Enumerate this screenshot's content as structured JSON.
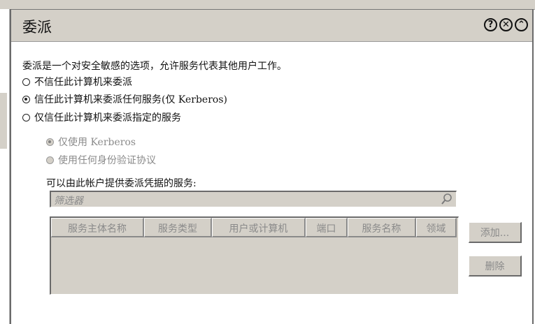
{
  "dialog": {
    "title": "委派",
    "header_buttons": {
      "help_icon": "?",
      "close_icon": "✕",
      "collapse_icon": "⌃"
    }
  },
  "description": "委派是一个对安全敏感的选项，允许服务代表其他用户工作。",
  "delegation_options": [
    {
      "label": "不信任此计算机来委派",
      "selected": false
    },
    {
      "label": "信任此计算机来委派任何服务(仅 Kerberos)",
      "selected": true
    },
    {
      "label": "仅信任此计算机来委派指定的服务",
      "selected": false
    }
  ],
  "protocol_options": [
    {
      "label": "仅使用 Kerberos",
      "selected": true,
      "disabled": true
    },
    {
      "label": "使用任何身份验证协议",
      "selected": false,
      "disabled": true
    }
  ],
  "services_label": "可以由此帐户提供委派凭据的服务:",
  "filter": {
    "placeholder": "筛选器"
  },
  "table": {
    "columns": [
      "服务主体名称",
      "服务类型",
      "用户或计算机",
      "端口",
      "服务名称",
      "领域"
    ],
    "rows": []
  },
  "buttons": {
    "add": "添加...",
    "remove": "删除"
  }
}
